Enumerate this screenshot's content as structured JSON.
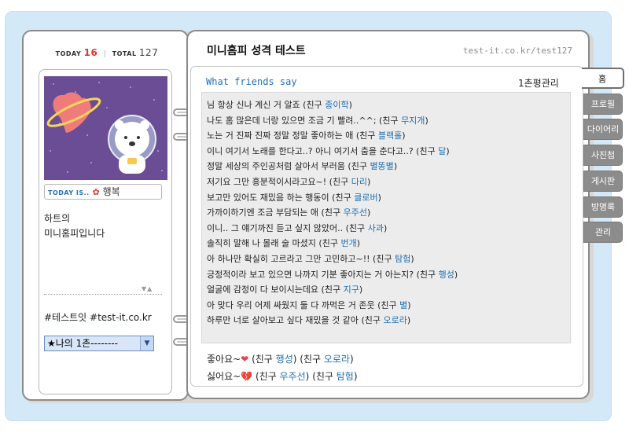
{
  "counter": {
    "today_label": "TODAY",
    "today_value": "16",
    "total_label": "TOTAL",
    "total_value": "127"
  },
  "profile": {
    "today_is_label": "TODAY IS..",
    "mood_icon": "flower-icon",
    "mood": "행복",
    "intro_line1": "하트의",
    "intro_line2": "미니홈피입니다",
    "hashtags": "#테스트잇 #test-it.co.kr",
    "friend_select": "★나의 1촌--------"
  },
  "header": {
    "title": "미니홈피 성격 테스트",
    "url": "test-it.co.kr/test127"
  },
  "section": {
    "title": "What friends say",
    "manage_link": "1촌평관리"
  },
  "comments": [
    {
      "text": "님 항상 신나 계신 거 알죠 (친구 ",
      "friend": "종이학",
      "end": ")"
    },
    {
      "text": "나도 홈 많은데 너랑 있으면 조금 기 빨려..^^; (친구 ",
      "friend": "무지개",
      "end": ")"
    },
    {
      "text": "노는 거 진짜 진짜 정말 정말 좋아하는 애 (친구 ",
      "friend": "블랙홀",
      "end": ")"
    },
    {
      "text": "이니 여기서 노래를 한다고..? 아니 여기서 춤을 춘다고..? (친구 ",
      "friend": "달",
      "end": ")"
    },
    {
      "text": "정말 세상의 주인공처럼 살아서 부러움 (친구 ",
      "friend": "별똥별",
      "end": ")"
    },
    {
      "text": "저기요 그만 흥분적이시라고요~! (친구 ",
      "friend": "다리",
      "end": ")"
    },
    {
      "text": "보고만 있어도 재밌음 하는 행동이 (친구 ",
      "friend": "클로버",
      "end": ")"
    },
    {
      "text": "가까이하기엔 조금 부담되는 애 (친구 ",
      "friend": "우주선",
      "end": ")"
    },
    {
      "text": "이니.. 그 얘기까진 듣고 싶지 않았어.. (친구 ",
      "friend": "사과",
      "end": ")"
    },
    {
      "text": "솔직히 말해 나 몰래 술 마셨지 (친구 ",
      "friend": "번개",
      "end": ")"
    },
    {
      "text": "아 하나만 확실히 고르라고 그만 고민하고~!! (친구 ",
      "friend": "탐험",
      "end": ")"
    },
    {
      "text": "긍정적이라 보고 있으면 나까지 기분 좋아지는 거 아는지? (친구 ",
      "friend": "행성",
      "end": ")"
    },
    {
      "text": "얼굴에 감정이 다 보이시는데요 (친구 ",
      "friend": "지구",
      "end": ")"
    },
    {
      "text": "아 맞다 우리 어제 싸웠지 둘 다 까먹은 거 존웃 (친구 ",
      "friend": "별",
      "end": ")"
    },
    {
      "text": "하루만 너로 살아보고 싶다 재밌을 것 같아 (친구 ",
      "friend": "오로라",
      "end": ")"
    }
  ],
  "likes": {
    "like_label": "좋아요~",
    "like_icon": "heart-icon",
    "like_friend_prefix": "(친구 ",
    "like_friends": [
      "행성",
      "오로라"
    ],
    "dislike_label": "싫어요~",
    "dislike_icon": "broken-heart-icon",
    "dislike_friends": [
      "우주선",
      "탐험"
    ]
  },
  "tabs": [
    "홈",
    "프로필",
    "다이어리",
    "사진첩",
    "게시판",
    "방명록",
    "관리"
  ],
  "colors": {
    "accent_blue": "#2a6fb3",
    "frame_blue": "#d3e9f8",
    "tab_gray": "#8c8c8c",
    "counter_red": "#e0362a"
  }
}
